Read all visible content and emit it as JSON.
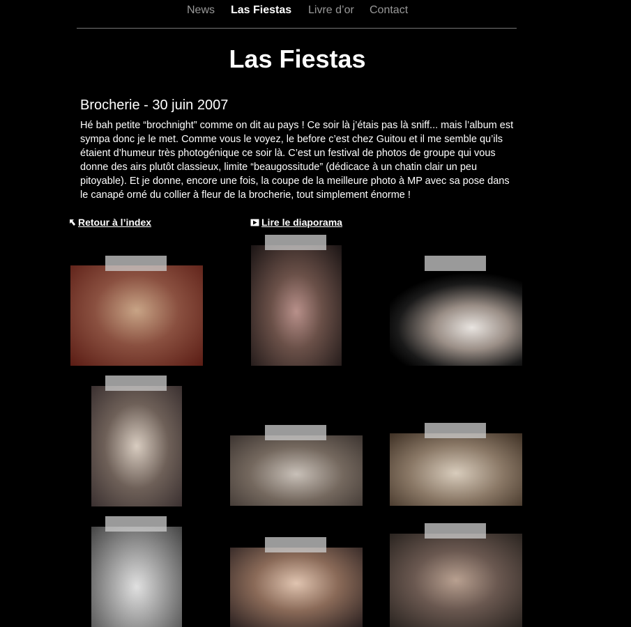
{
  "nav": {
    "items": [
      {
        "label": "News",
        "active": false
      },
      {
        "label": "Las Fiestas",
        "active": true
      },
      {
        "label": "Livre d’or",
        "active": false
      },
      {
        "label": "Contact",
        "active": false
      }
    ]
  },
  "page": {
    "title": "Las Fiestas",
    "subtitle": "Brocherie - 30 juin 2007",
    "description": "Hé bah petite “brochnight” comme on dit au pays ! Ce soir là j’étais pas là sniff... mais l’album est sympa donc je le met. Comme vous le voyez, le before c’est chez Guitou et il me semble qu’ils étaient d’humeur très photogénique ce soir là. C’est un festival de photos de groupe qui vous donne des airs plutôt classieux, limite “beaugossitude” (dédicace à un chatin clair un peu pitoyable). Et je donne, encore une fois, la coupe de la meilleure photo à MP avec sa pose dans le canapé orné du collier à fleur de la brocherie, tout simplement énorme !"
  },
  "links": {
    "back_label": "Retour à l’index",
    "back_icon": "arrow-up-left-icon",
    "slideshow_label": "Lire le diaporama",
    "slideshow_icon": "play-icon"
  },
  "colors": {
    "background": "#000000",
    "nav_inactive": "#999999",
    "text": "#ffffff",
    "divider": "#777777"
  }
}
